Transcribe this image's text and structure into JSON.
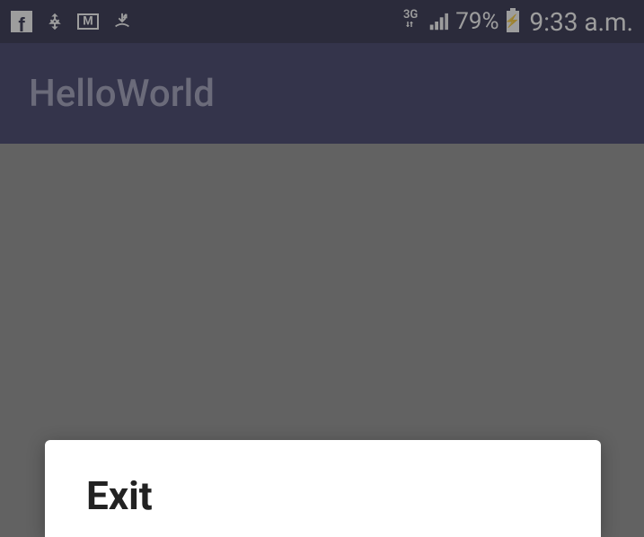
{
  "status_bar": {
    "network_type": "3G",
    "battery_percent": "79%",
    "time": "9:33 a.m."
  },
  "app_bar": {
    "title": "HelloWorld"
  },
  "dialog": {
    "title": "Exit"
  }
}
